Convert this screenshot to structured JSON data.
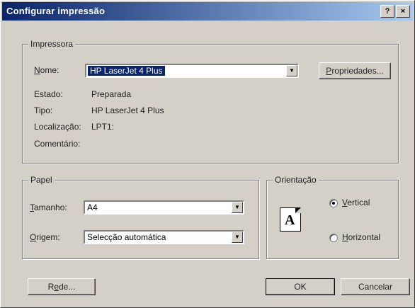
{
  "window": {
    "title": "Configurar impressão",
    "help_button": "?",
    "close_button": "×"
  },
  "printer": {
    "legend": "Impressora",
    "name_label": "Nome:",
    "name_value": "HP LaserJet 4 Plus",
    "properties_button": "Propriedades...",
    "status_label": "Estado:",
    "status_value": "Preparada",
    "type_label": "Tipo:",
    "type_value": "HP LaserJet 4 Plus",
    "location_label": "Localização:",
    "location_value": "LPT1:",
    "comment_label": "Comentário:",
    "comment_value": ""
  },
  "paper": {
    "legend": "Papel",
    "size_label": "Tamanho:",
    "size_value": "A4",
    "source_label": "Origem:",
    "source_value": "Selecção automática"
  },
  "orientation": {
    "legend": "Orientação",
    "icon_letter": "A",
    "vertical_label": "Vertical",
    "horizontal_label": "Horizontal",
    "selected": "Vertical"
  },
  "buttons": {
    "network": "Rede...",
    "ok": "OK",
    "cancel": "Cancelar"
  },
  "icons": [
    "help-icon",
    "close-icon",
    "dropdown-arrow-icon",
    "portrait-page-icon"
  ]
}
